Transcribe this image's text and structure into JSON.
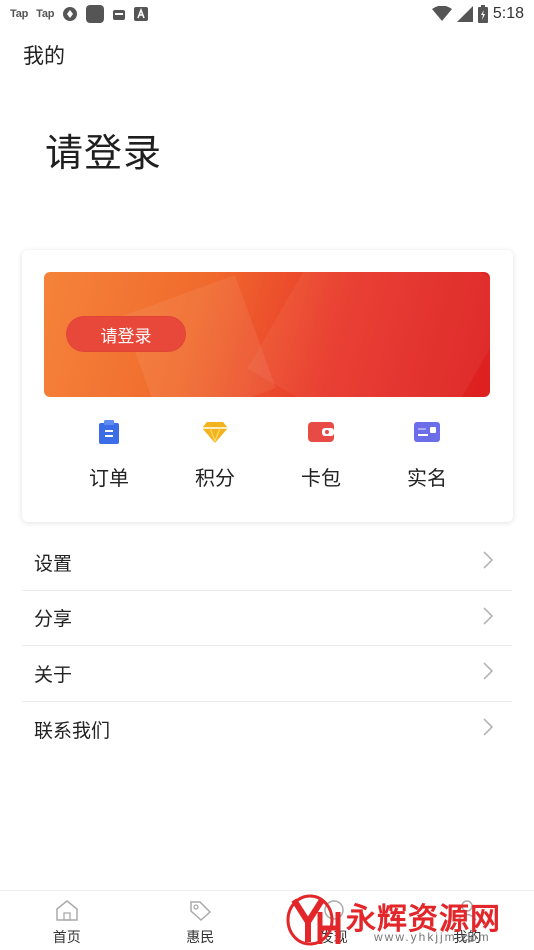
{
  "status_bar": {
    "apps": [
      "Tap",
      "Tap"
    ],
    "time": "5:18",
    "icons": [
      "refresh-icon",
      "square-app-icon",
      "robot-icon",
      "font-a-icon",
      "wifi-icon",
      "signal-icon",
      "battery-icon"
    ]
  },
  "page": {
    "title": "我的",
    "login_heading": "请登录"
  },
  "card": {
    "banner_button": "请登录",
    "quick_links": [
      {
        "label": "订单",
        "icon": "clipboard-icon",
        "color": "#3b6ee6"
      },
      {
        "label": "积分",
        "icon": "diamond-icon",
        "color": "#f2b41c"
      },
      {
        "label": "卡包",
        "icon": "wallet-icon",
        "color": "#e84b45"
      },
      {
        "label": "实名",
        "icon": "id-card-icon",
        "color": "#6b6ee8"
      }
    ]
  },
  "menu": [
    {
      "label": "设置"
    },
    {
      "label": "分享"
    },
    {
      "label": "关于"
    },
    {
      "label": "联系我们"
    }
  ],
  "bottom_nav": [
    {
      "label": "首页",
      "icon": "home-icon"
    },
    {
      "label": "惠民",
      "icon": "tag-icon"
    },
    {
      "label": "发现",
      "icon": "discover-icon"
    },
    {
      "label": "我的",
      "icon": "profile-icon"
    }
  ],
  "watermark": {
    "logo": "YH",
    "text": "永辉资源网",
    "url": "www.yhkjjm.com"
  },
  "colors": {
    "accent": "#e8362a",
    "banner_start": "#f5833a",
    "banner_end": "#dd1f1f"
  }
}
